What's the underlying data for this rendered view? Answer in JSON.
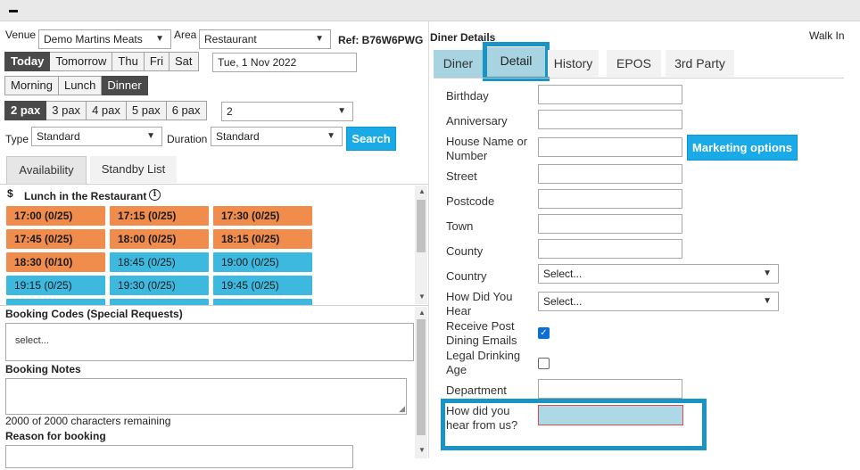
{
  "window": {
    "minimize_glyph": ""
  },
  "venue": {
    "label": "Venue",
    "value": "Demo Martins Meats"
  },
  "area": {
    "label": "Area",
    "value": "Restaurant"
  },
  "ref": {
    "text": "Ref: B76W6PWG"
  },
  "date_buttons": [
    "Today",
    "Tomorrow",
    "Thu",
    "Fri",
    "Sat"
  ],
  "date_value": "Tue, 1 Nov 2022",
  "meal_buttons": [
    "Morning",
    "Lunch",
    "Dinner"
  ],
  "pax_buttons": [
    "2 pax",
    "3 pax",
    "4 pax",
    "5 pax",
    "6 pax"
  ],
  "pax_select": "2",
  "type": {
    "label": "Type",
    "value": "Standard"
  },
  "duration": {
    "label": "Duration",
    "value": "Standard"
  },
  "search_label": "Search",
  "left_tabs": [
    "Availability",
    "Standby List"
  ],
  "availability": {
    "currency_symbol": "$",
    "heading": "Lunch in the Restaurant",
    "slots": [
      {
        "time": "17:00 (0/25)",
        "status": "orange"
      },
      {
        "time": "17:15 (0/25)",
        "status": "orange"
      },
      {
        "time": "17:30 (0/25)",
        "status": "orange"
      },
      {
        "time": "17:45 (0/25)",
        "status": "orange"
      },
      {
        "time": "18:00 (0/25)",
        "status": "orange"
      },
      {
        "time": "18:15 (0/25)",
        "status": "orange"
      },
      {
        "time": "18:30 (0/10)",
        "status": "orange"
      },
      {
        "time": "18:45 (0/25)",
        "status": "blue"
      },
      {
        "time": "19:00 (0/25)",
        "status": "blue"
      },
      {
        "time": "19:15 (0/25)",
        "status": "blue"
      },
      {
        "time": "19:30 (0/25)",
        "status": "blue"
      },
      {
        "time": "19:45 (0/25)",
        "status": "blue"
      }
    ]
  },
  "booking_codes": {
    "title": "Booking Codes (Special Requests)",
    "placeholder": "select..."
  },
  "booking_notes": {
    "title": "Booking Notes",
    "remaining": "2000 of 2000 characters remaining"
  },
  "reason": {
    "title": "Reason for booking"
  },
  "right": {
    "title": "Diner Details",
    "walk_in": "Walk In",
    "tabs": [
      "Diner",
      "Detail",
      "History",
      "EPOS",
      "3rd Party"
    ],
    "marketing_label": "Marketing options",
    "fields": {
      "birthday": "Birthday",
      "anniversary": "Anniversary",
      "house": "House Name or Number",
      "street": "Street",
      "postcode": "Postcode",
      "town": "Town",
      "county": "County",
      "country": "Country",
      "country_value": "Select...",
      "how_did_you_hear": "How Did You Hear",
      "how_value": "Select...",
      "receive_post": "Receive Post Dining Emails",
      "receive_post_checked": true,
      "legal_drinking": "Legal Drinking Age",
      "legal_drinking_checked": false,
      "department": "Department",
      "how_hear_us": "How did you hear from us?"
    }
  },
  "colors": {
    "orange_slot": "#f08c4c",
    "blue_slot": "#3db8df",
    "active_dark": "#4a4a4a",
    "accent_blue": "#1aaae8",
    "highlight": "#1a94c5"
  }
}
